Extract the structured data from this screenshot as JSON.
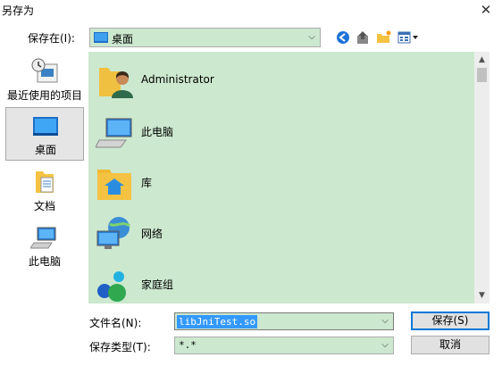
{
  "window": {
    "title": "另存为",
    "close_glyph": "✕"
  },
  "location": {
    "label": "保存在(I):",
    "value": "桌面"
  },
  "toolbar": {
    "icons": [
      "back-icon",
      "up-folder-icon",
      "new-folder-icon",
      "view-menu-icon"
    ]
  },
  "places": [
    {
      "label": "最近使用的项目",
      "icon": "recent-items-icon",
      "selected": false
    },
    {
      "label": "桌面",
      "icon": "desktop-icon",
      "selected": true
    },
    {
      "label": "文档",
      "icon": "documents-icon",
      "selected": false
    },
    {
      "label": "此电脑",
      "icon": "this-pc-icon",
      "selected": false
    }
  ],
  "files": [
    {
      "label": "Administrator",
      "icon": "user-folder-icon"
    },
    {
      "label": "此电脑",
      "icon": "computer-icon"
    },
    {
      "label": "库",
      "icon": "libraries-icon"
    },
    {
      "label": "网络",
      "icon": "network-icon"
    },
    {
      "label": "家庭组",
      "icon": "homegroup-icon"
    }
  ],
  "form": {
    "filename_label": "文件名(N):",
    "filename_value": "libJniTest.so",
    "filetype_label": "保存类型(T):",
    "filetype_value": "*.*"
  },
  "buttons": {
    "save": "保存(S)",
    "cancel": "取消"
  },
  "colors": {
    "list_background": "#cce8cf",
    "selection": "#3399ff",
    "default_button_border": "#0078d7"
  }
}
